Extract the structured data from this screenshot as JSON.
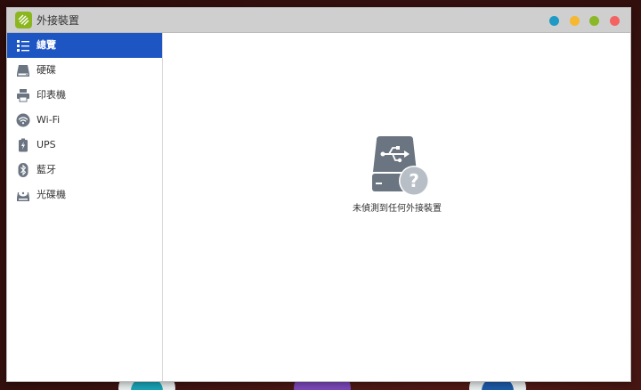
{
  "window": {
    "title": "外接裝置",
    "app_icon": "external-devices-app-icon",
    "controls": [
      {
        "name": "window-control-blue",
        "color": "#1e9ac4"
      },
      {
        "name": "window-control-yellow",
        "color": "#f5b830"
      },
      {
        "name": "window-control-green",
        "color": "#8ab827"
      },
      {
        "name": "window-control-red",
        "color": "#f46363"
      }
    ]
  },
  "sidebar": {
    "items": [
      {
        "label": "總覽",
        "icon": "overview-list-icon",
        "active": true
      },
      {
        "label": "硬碟",
        "icon": "hard-disk-icon",
        "active": false
      },
      {
        "label": "印表機",
        "icon": "printer-icon",
        "active": false
      },
      {
        "label": "Wi-Fi",
        "icon": "wifi-icon",
        "active": false
      },
      {
        "label": "UPS",
        "icon": "ups-battery-icon",
        "active": false
      },
      {
        "label": "藍牙",
        "icon": "bluetooth-icon",
        "active": false
      },
      {
        "label": "光碟機",
        "icon": "optical-drive-icon",
        "active": false
      }
    ]
  },
  "main": {
    "empty_icon": "usb-drive-unknown-icon",
    "empty_message": "未偵測到任何外接裝置"
  },
  "colors": {
    "active_nav": "#1d56c2",
    "titlebar": "#cfcfcf",
    "icon_gray": "#6b7582"
  }
}
